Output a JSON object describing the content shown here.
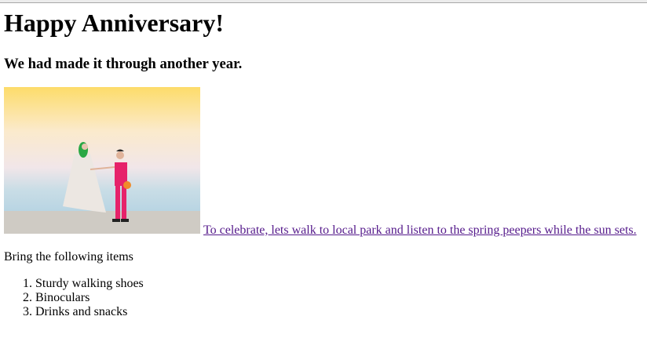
{
  "heading": "Happy Anniversary!",
  "subheading": "We had made it through another year.",
  "image": {
    "alt": "wedding-couple-photo"
  },
  "link_text": "To celebrate, lets walk to local park and listen to the spring peepers while the sun sets.",
  "intro": "Bring the following items",
  "items": [
    "Sturdy walking shoes",
    "Binoculars",
    "Drinks and snacks"
  ]
}
